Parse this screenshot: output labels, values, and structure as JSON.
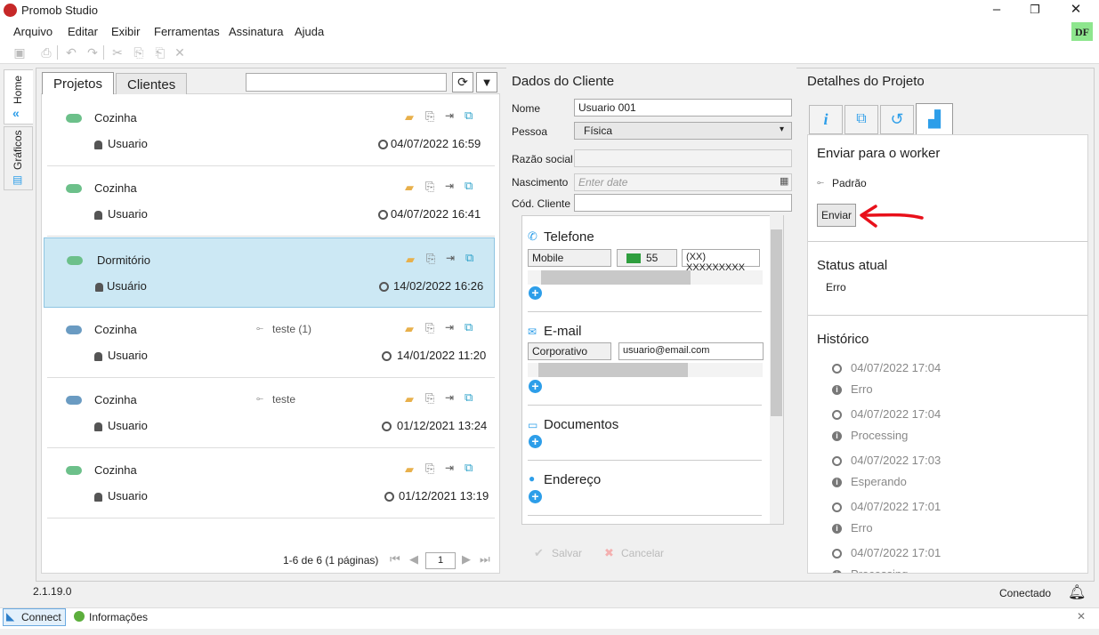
{
  "app": {
    "title": "Promob Studio",
    "user_initials": "DF"
  },
  "window": {
    "minimize": "–",
    "restore": "❐",
    "close": "✕"
  },
  "menu": [
    "Arquivo",
    "Editar",
    "Exibir",
    "Ferramentas",
    "Assinatura",
    "Ajuda"
  ],
  "sidetabs": {
    "home": "Home",
    "graficos": "Gráficos"
  },
  "projects_panel": {
    "tabs": [
      "Projetos",
      "Clientes"
    ],
    "search": {
      "value": "",
      "placeholder": ""
    },
    "rows": [
      {
        "name": "Cozinha",
        "tag": "",
        "user": "Usuario",
        "date": "04/07/2022 16:59",
        "cloud": "green"
      },
      {
        "name": "Cozinha",
        "tag": "",
        "user": "Usuario",
        "date": "04/07/2022 16:41",
        "cloud": "green"
      },
      {
        "name": "Dormitório",
        "tag": "",
        "user": "Usuário",
        "date": "14/02/2022 16:26",
        "cloud": "green"
      },
      {
        "name": "Cozinha",
        "tag": "teste (1)",
        "user": "Usuario",
        "date": "14/01/2022 11:20",
        "cloud": "blue"
      },
      {
        "name": "Cozinha",
        "tag": "teste",
        "user": "Usuario",
        "date": "01/12/2021 13:24",
        "cloud": "blue"
      },
      {
        "name": "Cozinha",
        "tag": "",
        "user": "Usuario",
        "date": "01/12/2021 13:19",
        "cloud": "green"
      }
    ],
    "pagination": {
      "summary": "1-6 de 6 (1 páginas)",
      "page": "1"
    }
  },
  "client_panel": {
    "title": "Dados do Cliente",
    "labels": {
      "nome": "Nome",
      "pessoa": "Pessoa",
      "razao": "Razão social",
      "nascimento": "Nascimento",
      "codigo": "Cód. Cliente"
    },
    "values": {
      "nome": "Usuario 001",
      "pessoa": "Física",
      "razao": "",
      "nascimento_placeholder": "Enter date",
      "codigo": ""
    },
    "telefone": {
      "title": "Telefone",
      "type": "Mobile",
      "code": "55",
      "number": "(XX) XXXXXXXXX"
    },
    "email": {
      "title": "E-mail",
      "type": "Corporativo",
      "value": "usuario@email.com"
    },
    "documentos": {
      "title": "Documentos"
    },
    "endereco": {
      "title": "Endereço"
    },
    "buttons": {
      "save": "Salvar",
      "cancel": "Cancelar"
    }
  },
  "details_panel": {
    "title": "Detalhes do Projeto",
    "worker": {
      "title": "Enviar para o worker",
      "option": "Padrão",
      "button": "Enviar"
    },
    "status": {
      "title": "Status atual",
      "value": "Erro"
    },
    "history": {
      "title": "Histórico",
      "items": [
        {
          "date": "04/07/2022 17:04",
          "status": "Erro"
        },
        {
          "date": "04/07/2022 17:04",
          "status": "Processing"
        },
        {
          "date": "04/07/2022 17:03",
          "status": "Esperando"
        },
        {
          "date": "04/07/2022 17:01",
          "status": "Erro"
        },
        {
          "date": "04/07/2022 17:01",
          "status": "Processing"
        }
      ]
    }
  },
  "statusbar": {
    "version": "2.1.19.0",
    "connection": "Conectado"
  },
  "bottombar": {
    "connect": "Connect",
    "info": "Informações"
  },
  "colors": {
    "accent": "#2d9ee9",
    "selected_row": "#cce8f4",
    "arrow": "#e8101a"
  }
}
